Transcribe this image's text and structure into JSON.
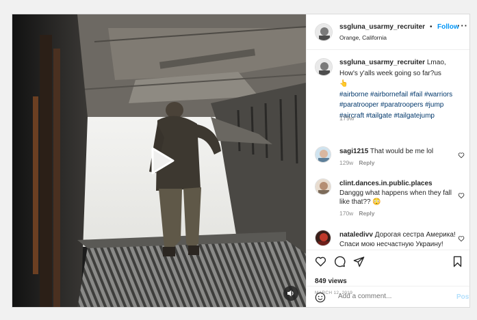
{
  "post": {
    "username": "ssgluna_usarmy_recruiter",
    "dot": "•",
    "follow_label": "Follow",
    "location": "Orange, California",
    "more_label": "···",
    "caption": {
      "username": "ssgluna_usarmy_recruiter",
      "text": "Lmao, How's y'alls week going so far?us",
      "emoji": "👆",
      "hashtags": [
        "#airborne",
        "#airbornefail",
        "#fail",
        "#warriors",
        "#paratrooper",
        "#paratroopers",
        "#jump",
        "#aircraft",
        "#tailgate",
        "#tailgatejump"
      ],
      "age": "179w"
    },
    "comments": [
      {
        "username": "sagi1215",
        "text": "That would be me lol",
        "age": "129w",
        "reply_label": "Reply"
      },
      {
        "username": "clint.dances.in.public.places",
        "text": "Danggg what happens when they fall like that??",
        "emoji": "😳",
        "age": "170w",
        "reply_label": "Reply"
      },
      {
        "username": "nataledivv",
        "text": "Дорогая сестра Америка! Спаси мою несчастную Украину!"
      }
    ],
    "views": "849 views",
    "date": "MARCH 12, 2019",
    "comment_placeholder": "Add a comment...",
    "post_label": "Post"
  },
  "icons": {
    "play": "play-icon",
    "sound": "sound-icon",
    "like": "heart-icon",
    "comment": "comment-icon",
    "share": "share-icon",
    "save": "bookmark-icon",
    "emoji": "smiley-icon"
  },
  "colors": {
    "link": "#0095f6",
    "hashtag": "#00376b",
    "muted": "#8e8e8e",
    "post_disabled": "#b2dffc"
  }
}
